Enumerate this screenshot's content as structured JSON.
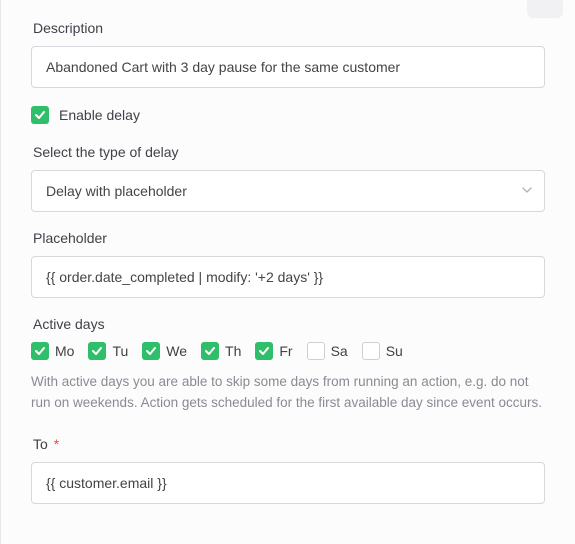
{
  "description": {
    "label": "Description",
    "value": "Abandoned Cart with 3 day pause for the same customer"
  },
  "enable_delay": {
    "label": "Enable delay",
    "checked": true
  },
  "delay_type": {
    "label": "Select the type of delay",
    "value": "Delay with placeholder"
  },
  "placeholder_field": {
    "label": "Placeholder",
    "value": "{{ order.date_completed | modify: '+2 days' }}"
  },
  "active_days": {
    "label": "Active days",
    "help": "With active days you are able to skip some days from running an action, e.g. do not run on weekends. Action gets scheduled for the first available day since event occurs.",
    "days": [
      {
        "code": "Mo",
        "checked": true
      },
      {
        "code": "Tu",
        "checked": true
      },
      {
        "code": "We",
        "checked": true
      },
      {
        "code": "Th",
        "checked": true
      },
      {
        "code": "Fr",
        "checked": true
      },
      {
        "code": "Sa",
        "checked": false
      },
      {
        "code": "Su",
        "checked": false
      }
    ]
  },
  "to": {
    "label": "To",
    "required_mark": "*",
    "value": "{{ customer.email }}"
  }
}
